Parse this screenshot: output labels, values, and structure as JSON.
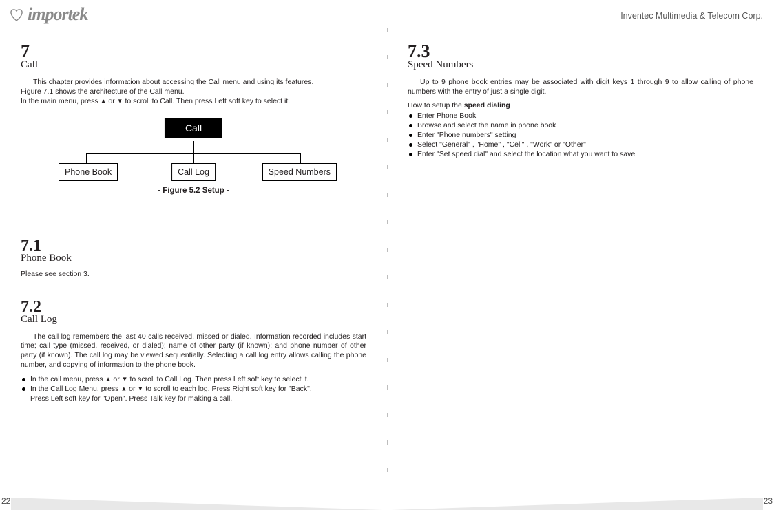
{
  "header": {
    "logo_text": "importek",
    "corp": "Inventec Multimedia & Telecom Corp."
  },
  "left": {
    "ch_num": "7",
    "ch_title": "Call",
    "intro_line1": "This chapter provides information about accessing the Call menu and using its features.",
    "intro_line2": "Figure 7.1 shows the architecture of the Call menu.",
    "intro_line3a": "In the main menu, press ",
    "intro_line3b": " or ",
    "intro_line3c": " to scroll to Call. Then press Left soft key to select it.",
    "diagram": {
      "root": "Call",
      "box1": "Phone Book",
      "box2": "Call Log",
      "box3": "Speed Numbers",
      "caption": "- Figure 5.2 Setup -"
    },
    "s71_num": "7.1",
    "s71_title": "Phone Book",
    "s71_body": "Please see section 3.",
    "s72_num": "7.2",
    "s72_title": "Call Log",
    "s72_body": "The call log remembers the last 40 calls received, missed or dialed. Information recorded includes start time; call type (missed, received, or dialed); name of other party (if known); and phone number of other party (if known). The call log may be viewed sequentially. Selecting a call log entry allows calling the phone number, and copying of information to the phone book.",
    "s72_b1a": "In the call menu, press ",
    "s72_b1b": " or ",
    "s72_b1c": " to scroll to Call Log. Then press Left soft key to select it.",
    "s72_b2a": "In the Call Log Menu, press ",
    "s72_b2b": " or ",
    "s72_b2c": " to scroll to each log. Press Right soft key for \"Back\".",
    "s72_b2d": "Press Left soft key for \"Open\". Press Talk key for making a call."
  },
  "right": {
    "s73_num": "7.3",
    "s73_title": "Speed Numbers",
    "s73_body": "Up to 9 phone book entries may be associated with digit keys 1 through 9 to allow calling of phone numbers with the entry of just a single digit.",
    "howto_prefix": "How to setup the ",
    "howto_bold": "speed dialing",
    "items": [
      "Enter Phone Book",
      "Browse and select the name in phone book",
      "Enter \"Phone numbers\" setting",
      "Select \"General\" , \"Home\" , \"Cell\" , \"Work\" or \"Other\"",
      "Enter \"Set speed dial\" and select the location what you want to save"
    ]
  },
  "pagenum_left": "22",
  "pagenum_right": "23",
  "glyph_up": "▲",
  "glyph_down": "▼"
}
